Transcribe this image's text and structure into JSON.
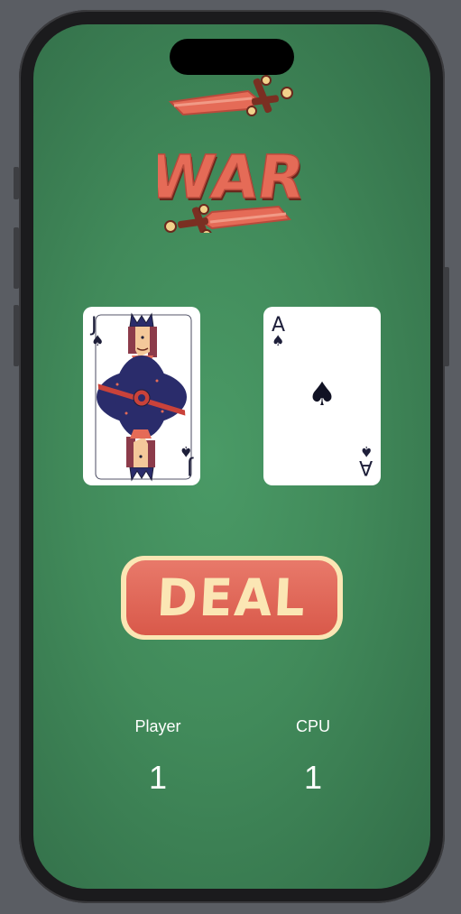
{
  "app": {
    "logo_text": "WAR",
    "logo_icon": "crossed-swords-logo"
  },
  "cards": {
    "player": {
      "rank": "J",
      "suit": "♠",
      "name": "jack-of-spades"
    },
    "cpu": {
      "rank": "A",
      "suit": "♠",
      "name": "ace-of-spades"
    }
  },
  "deal_button": {
    "label": "DEAL"
  },
  "scores": {
    "player": {
      "label": "Player",
      "value": "1"
    },
    "cpu": {
      "label": "CPU",
      "value": "1"
    }
  },
  "colors": {
    "table_green": "#418a5a",
    "button_red": "#e06a5a",
    "button_cream": "#fbe6b4",
    "card_ink": "#1e1f3a"
  }
}
